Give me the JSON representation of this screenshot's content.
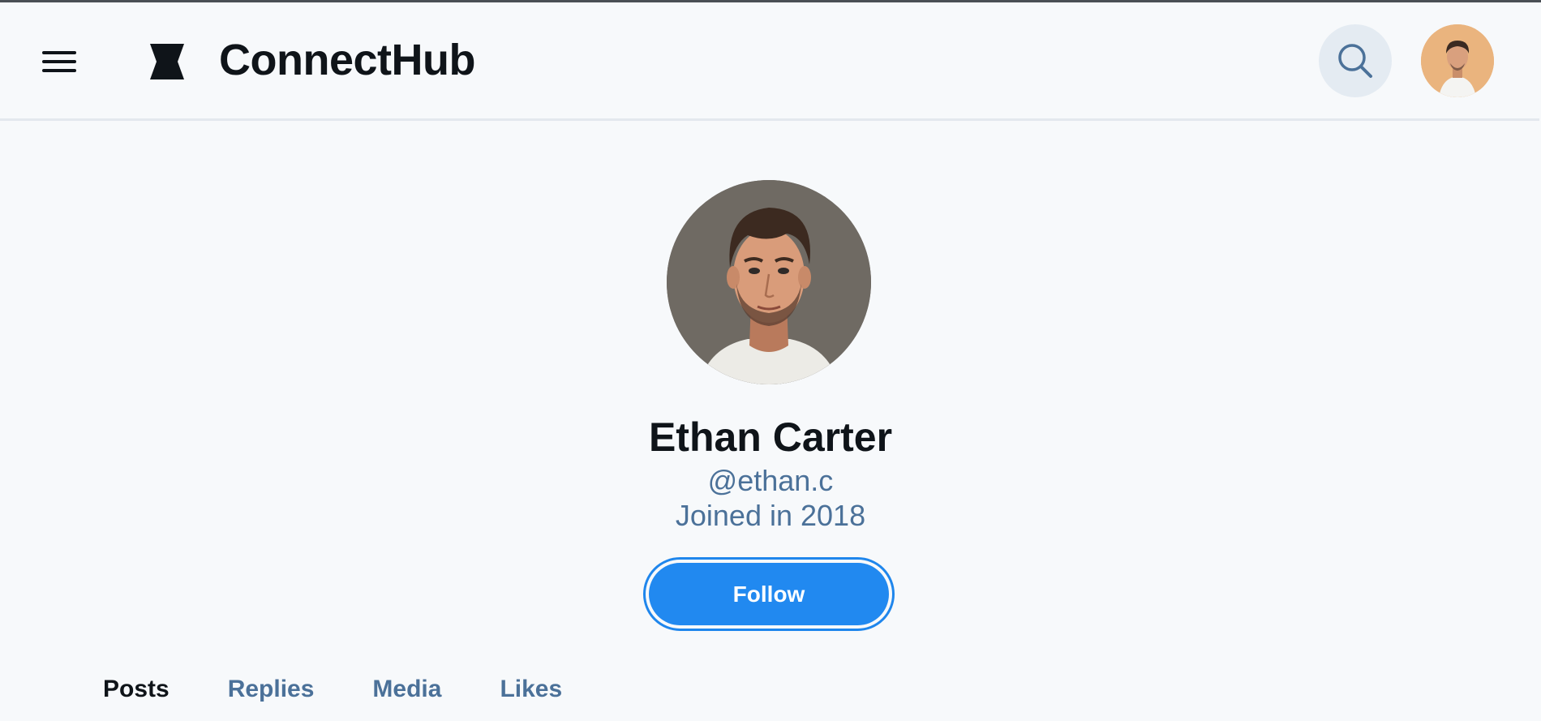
{
  "header": {
    "menu_icon": "hamburger-menu-icon",
    "logo_icon": "connecthub-logo-icon",
    "brand": "ConnectHub",
    "search_icon": "search-icon",
    "user_avatar_icon": "user-avatar"
  },
  "profile": {
    "name": "Ethan Carter",
    "handle": "@ethan.c",
    "joined": "Joined in 2018",
    "follow_label": "Follow"
  },
  "tabs": [
    {
      "label": "Posts",
      "active": true
    },
    {
      "label": "Replies",
      "active": false
    },
    {
      "label": "Media",
      "active": false
    },
    {
      "label": "Likes",
      "active": false
    }
  ],
  "colors": {
    "background": "#f7f9fb",
    "accent": "#2189f0",
    "secondary_text": "#4b7199",
    "primary_text": "#0f1419"
  }
}
